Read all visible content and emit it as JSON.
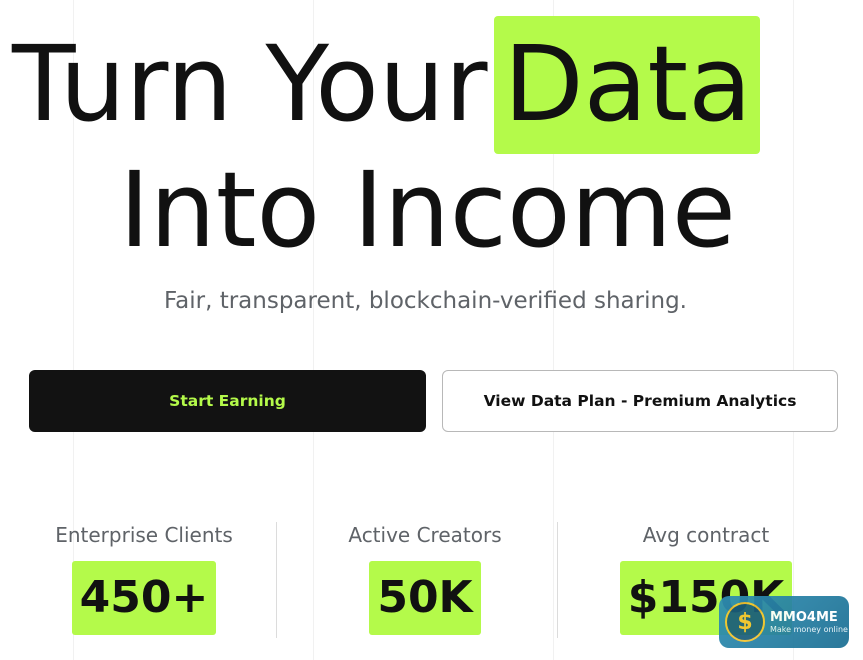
{
  "hero": {
    "line1_text": "Turn Your",
    "line1_highlight": "Data",
    "line2_text": "Into Income"
  },
  "subtitle": "Fair, transparent, blockchain-verified sharing.",
  "buttons": {
    "primary_label": "Start Earning",
    "secondary_label": "View Data Plan - Premium Analytics"
  },
  "stats": [
    {
      "label": "Enterprise Clients",
      "value": "450+"
    },
    {
      "label": "Active Creators",
      "value": "50K"
    },
    {
      "label": "Avg contract",
      "value": "$150K"
    }
  ],
  "watermark": {
    "symbol": "$",
    "title": "MMO4ME",
    "subtitle": "Make money online"
  },
  "colors": {
    "accent": "#b4fa4a",
    "dark": "#121212",
    "muted_text": "#5f6368"
  }
}
